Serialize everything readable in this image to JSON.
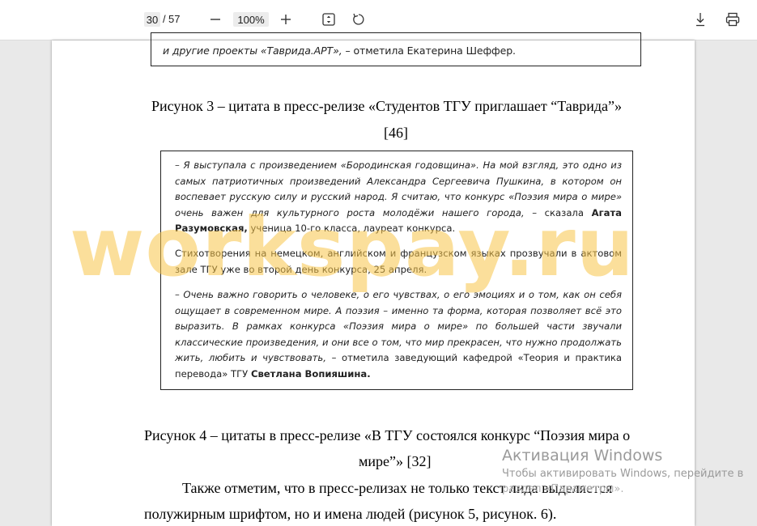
{
  "toolbar": {
    "current_page": "30",
    "page_separator": "/",
    "total_pages": "57",
    "zoom": "100%",
    "icons": {
      "zoom_out": "minus-icon",
      "zoom_in": "plus-icon",
      "fit": "fit-page-icon",
      "rotate": "rotate-icon",
      "download": "download-icon",
      "print": "printer-icon"
    }
  },
  "document": {
    "box1": {
      "italic": "и другие проекты «Таврида.АРТ»,",
      "rest": " – отметила Екатерина Шеффер."
    },
    "caption3_line1": "Рисунок 3 – цитата в пресс-релизе «Студентов ТГУ приглашает “Таврида”»",
    "caption3_line2": "[46]",
    "box2": {
      "p1_italic": "– Я выступала с произведением «Бородинская годовщина». На мой взгляд, это одно из самых патриотичных произведений Александра Сергеевича Пушкина, в котором он воспевает русскую силу и русский народ. Я считаю, что конкурс «Поэзия мира о мире» очень важен для культурного роста молодёжи нашего города,",
      "p1_rest": " – сказала ",
      "p1_bold": "Агата Разумовская,",
      "p1_end": " ученица 10-го класса, лауреат конкурса.",
      "p2": "Стихотворения на немецком, английском и французском языках прозвучали в актовом зале ТГУ уже во второй день конкурса, 25 апреля.",
      "p3_italic": "– Очень важно говорить о человеке, о его чувствах, о его эмоциях и о том, как он себя ощущает в современном мире. А поэзия – именно та форма, которая позволяет всё это выразить. В рамках конкурса «Поэзия мира о мире» по большей части звучали классические произведения, и они все о том, что мир прекрасен, что нужно продолжать жить, любить и чувствовать,",
      "p3_rest": " – отметила заведующий кафедрой «Теория и практика перевода» ТГУ ",
      "p3_bold": "Светлана Вопияшина."
    },
    "caption4_line1": "Рисунок 4 – цитаты в пресс-релизе «В ТГУ состоялся конкурс “Поэзия мира о",
    "caption4_line2": "мире”» [32]",
    "body_line1": "Также отметим, что в пресс-релизах не только текст лида выделяется",
    "body_line2": "полужирным шрифтом, но и имена людей (рисунок 5, рисунок. 6)."
  },
  "watermark": "workspay.ru",
  "windows_activation": {
    "title": "Активация Windows",
    "subtitle": "Чтобы активировать Windows, перейдите в",
    "subtitle2": "раздел «Параметры»."
  }
}
